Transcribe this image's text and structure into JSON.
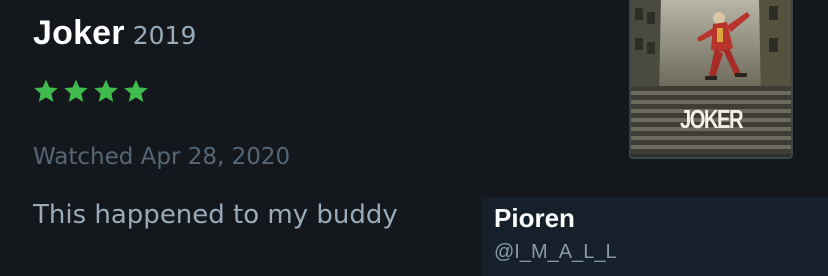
{
  "review": {
    "film_title": "Joker",
    "year": "2019",
    "rating_stars": 4,
    "star_color": "#40bc4f",
    "watched_date": "Watched Apr 28, 2020",
    "text": "This happened to my buddy"
  },
  "poster": {
    "title": "JOKER"
  },
  "user_card": {
    "display_name": "Pioren",
    "handle": "@I_M_A_L_L"
  },
  "colors": {
    "background": "#14181c",
    "card_background": "#15202b"
  }
}
